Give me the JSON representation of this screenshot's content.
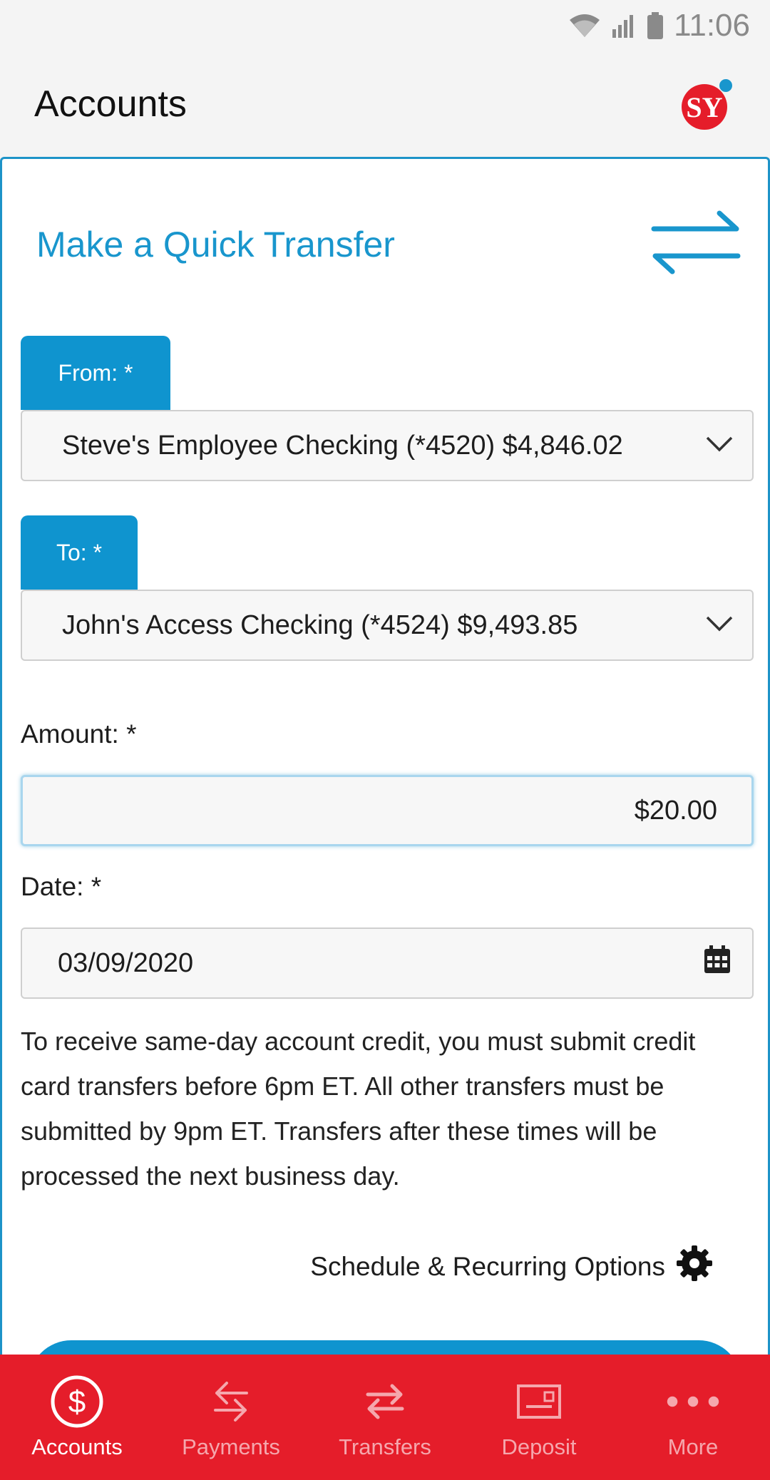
{
  "status_bar": {
    "time": "11:06",
    "icons": [
      "wifi-icon",
      "signal-icon",
      "battery-icon"
    ]
  },
  "header": {
    "title": "Accounts",
    "logo": "sy-bank-logo"
  },
  "transfer_card": {
    "title": "Make a Quick Transfer",
    "title_icon": "transfer-arrows-icon",
    "from": {
      "label": "From: *",
      "value": "Steve's Employee Checking (*4520) $4,846.02"
    },
    "to": {
      "label": "To: *",
      "value": "John's Access Checking (*4524) $9,493.85"
    },
    "amount": {
      "label": "Amount: *",
      "value": "$20.00"
    },
    "date": {
      "label": "Date: *",
      "value": "03/09/2020"
    },
    "notice": "To receive same-day account credit, you must submit credit card transfers before 6pm ET. All other transfers must be submitted by 9pm ET. Transfers after these times will be processed the next business day.",
    "schedule_link": "Schedule & Recurring Options"
  },
  "bottom_nav": {
    "items": [
      {
        "label": "Accounts",
        "icon": "dollar-circle-icon",
        "active": true
      },
      {
        "label": "Payments",
        "icon": "payments-icon",
        "active": false
      },
      {
        "label": "Transfers",
        "icon": "transfers-icon",
        "active": false
      },
      {
        "label": "Deposit",
        "icon": "check-deposit-icon",
        "active": false
      },
      {
        "label": "More",
        "icon": "more-dots-icon",
        "active": false
      }
    ]
  },
  "colors": {
    "accent_blue": "#0f94cf",
    "nav_red": "#e51d2a",
    "title_blue": "#1996cd"
  }
}
